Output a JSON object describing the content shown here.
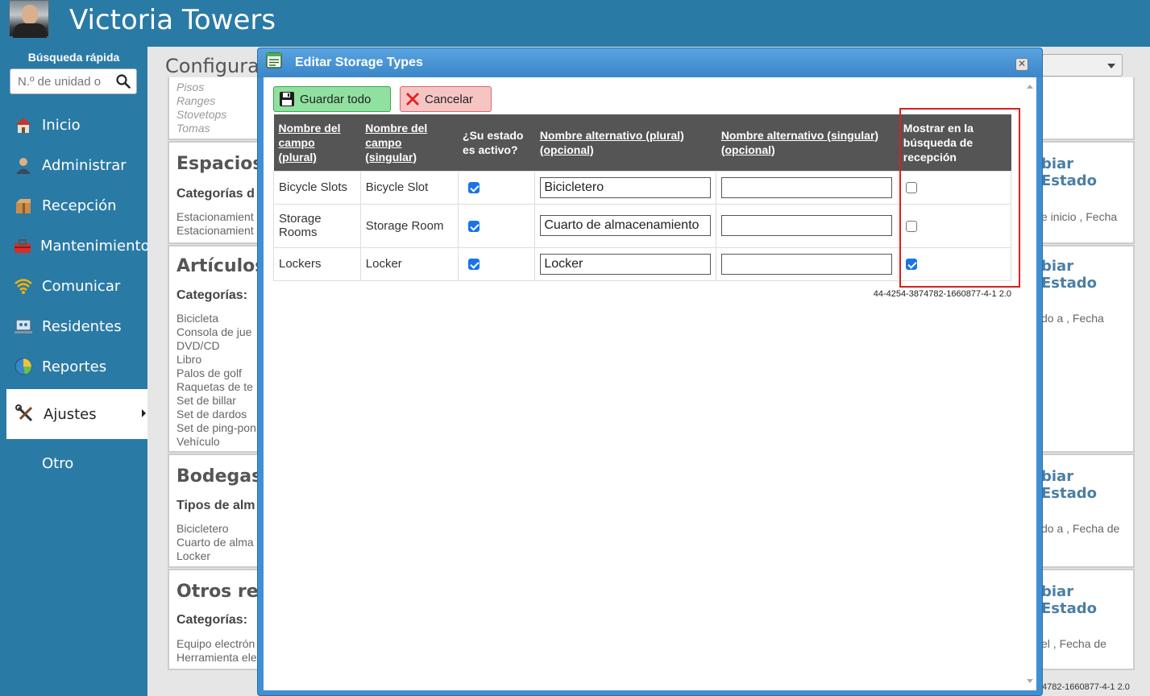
{
  "header": {
    "title": "Victoria Towers"
  },
  "sidebar": {
    "quick_search_label": "Búsqueda rápida",
    "quick_search_placeholder": "N.º de unidad o",
    "items": [
      {
        "label": "Inicio",
        "icon": "home-icon"
      },
      {
        "label": "Administrar",
        "icon": "admin-user-icon"
      },
      {
        "label": "Recepción",
        "icon": "package-icon"
      },
      {
        "label": "Mantenimiento",
        "icon": "toolbox-icon"
      },
      {
        "label": "Comunicar",
        "icon": "wifi-icon"
      },
      {
        "label": "Residentes",
        "icon": "residents-icon"
      },
      {
        "label": "Reportes",
        "icon": "pie-chart-icon"
      },
      {
        "label": "Ajustes",
        "icon": "tools-icon",
        "active": true
      },
      {
        "label": "Otro",
        "icon": ""
      }
    ]
  },
  "background": {
    "page_title": "Configurac",
    "faded_items": [
      "Pisos",
      "Ranges",
      "Stovetops",
      "Tomas"
    ],
    "sections": [
      {
        "title": "Espacios",
        "subtitle": "Categorías d",
        "items": [
          "Estacionamient",
          "Estacionamient"
        ],
        "right_link": "biar Estado",
        "right_text": "e inicio , Fecha"
      },
      {
        "title": "Artículos",
        "subtitle": "Categorías:",
        "items": [
          "Bicicleta",
          "Consola de jue",
          "DVD/CD",
          "Libro",
          "Palos de golf",
          "Raquetas de te",
          "Set de billar",
          "Set de dardos",
          "Set de ping-pon",
          "Vehículo"
        ],
        "right_link": "biar Estado",
        "right_text": "do a , Fecha"
      },
      {
        "title": "Bodegas",
        "subtitle": "Tipos de alm",
        "items": [
          "Bicicletero",
          "Cuarto de alma",
          "Locker"
        ],
        "right_link": "biar Estado",
        "right_text": "do a , Fecha de"
      },
      {
        "title": "Otros rec",
        "subtitle": "Categorías:",
        "items": [
          "Equipo electrón",
          "Herramienta ele"
        ],
        "right_link": "biar Estado",
        "right_text": "el , Fecha de"
      }
    ],
    "footer_code": "4782-1660877-4-1 2.0"
  },
  "modal": {
    "title": "Editar Storage Types",
    "save_label": "Guardar todo",
    "cancel_label": "Cancelar",
    "columns": [
      "Nombre del campo (plural)",
      "Nombre del campo (singular)",
      "¿Su estado es activo?",
      "Nombre alternativo (plural) (opcional)",
      "Nombre alternativo (singular) (opcional)",
      "Mostrar en la búsqueda de recepción"
    ],
    "rows": [
      {
        "plural": "Bicycle Slots",
        "singular": "Bicycle Slot",
        "active": true,
        "alt_plural": "Bicicletero",
        "alt_singular": "",
        "show_in_search": false
      },
      {
        "plural": "Storage Rooms",
        "singular": "Storage Room",
        "active": true,
        "alt_plural": "Cuarto de almacenamiento",
        "alt_singular": "",
        "show_in_search": false
      },
      {
        "plural": "Lockers",
        "singular": "Locker",
        "active": true,
        "alt_plural": "Locker",
        "alt_singular": "",
        "show_in_search": true
      }
    ],
    "version": "44-4254-3874782-1660877-4-1 2.0"
  },
  "colors": {
    "brand": "#2a7aa6",
    "modal_header": "#3f8fd2",
    "save_button": "#90e0a0",
    "cancel_button": "#f7c4c4",
    "highlight": "#d9201f",
    "table_header": "#555555"
  }
}
